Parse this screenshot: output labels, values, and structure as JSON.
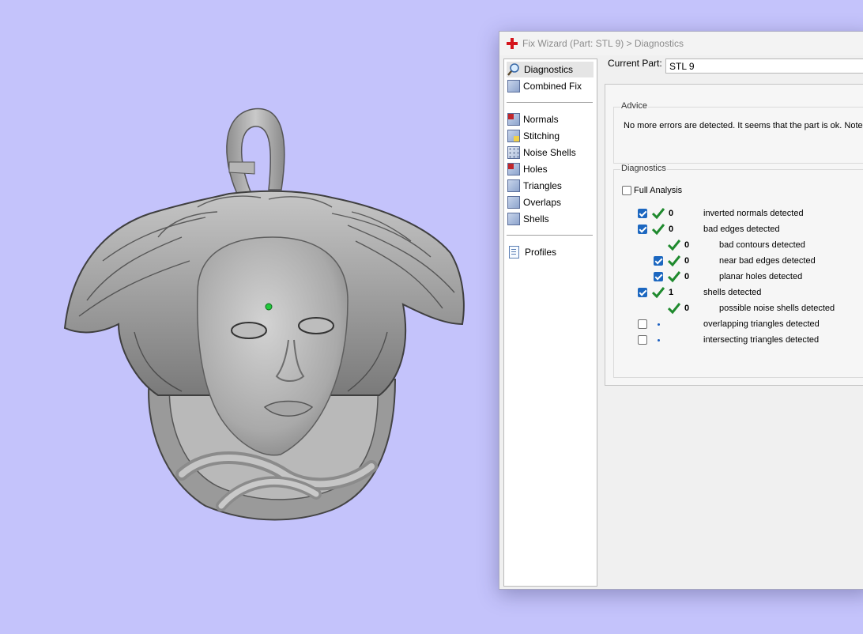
{
  "window": {
    "title": "Fix Wizard (Part: STL 9) > Diagnostics"
  },
  "nav": {
    "items": [
      {
        "label": "Diagnostics",
        "icon": "magnifier-icon"
      },
      {
        "label": "Combined Fix",
        "icon": "cube-icon"
      },
      {
        "label": "Normals",
        "icon": "cube-normals-icon"
      },
      {
        "label": "Stitching",
        "icon": "cube-stitching-icon"
      },
      {
        "label": "Noise Shells",
        "icon": "cube-noise-icon"
      },
      {
        "label": "Holes",
        "icon": "cube-holes-icon"
      },
      {
        "label": "Triangles",
        "icon": "cube-triangles-icon"
      },
      {
        "label": "Overlaps",
        "icon": "cube-overlaps-icon"
      },
      {
        "label": "Shells",
        "icon": "cube-shells-icon"
      },
      {
        "label": "Profiles",
        "icon": "document-icon"
      }
    ],
    "selected": "Diagnostics"
  },
  "current_part": {
    "label": "Current Part:",
    "value": "STL 9"
  },
  "advice": {
    "title": "Advice",
    "text": "No more errors are detected. It seems that the part is ok. Note"
  },
  "diagnostics": {
    "title": "Diagnostics",
    "full_analysis_label": "Full Analysis",
    "full_analysis_checked": false,
    "rows": [
      {
        "checked": true,
        "status": "ok",
        "count": "0",
        "label": "inverted normals detected",
        "indent": 0
      },
      {
        "checked": true,
        "status": "ok",
        "count": "0",
        "label": "bad edges detected",
        "indent": 0
      },
      {
        "checked": null,
        "status": "ok",
        "count": "0",
        "label": "bad contours detected",
        "indent": 1
      },
      {
        "checked": true,
        "status": "ok",
        "count": "0",
        "label": "near bad edges detected",
        "indent": 1
      },
      {
        "checked": true,
        "status": "ok",
        "count": "0",
        "label": "planar holes detected",
        "indent": 1
      },
      {
        "checked": true,
        "status": "ok",
        "count": "1",
        "label": "shells detected",
        "indent": 0
      },
      {
        "checked": null,
        "status": "ok",
        "count": "0",
        "label": "possible noise shells detected",
        "indent": 1
      },
      {
        "checked": false,
        "status": "unknown",
        "count": "",
        "label": "overlapping triangles detected",
        "indent": 0
      },
      {
        "checked": false,
        "status": "unknown",
        "count": "",
        "label": "intersecting triangles detected",
        "indent": 0
      }
    ]
  },
  "colors": {
    "background": "#c4c3fb",
    "check_green": "#1f8a2e",
    "checkbox_blue": "#1c67c0",
    "model_gray": "#9c9c9c",
    "marker_green": "#22c83c"
  }
}
